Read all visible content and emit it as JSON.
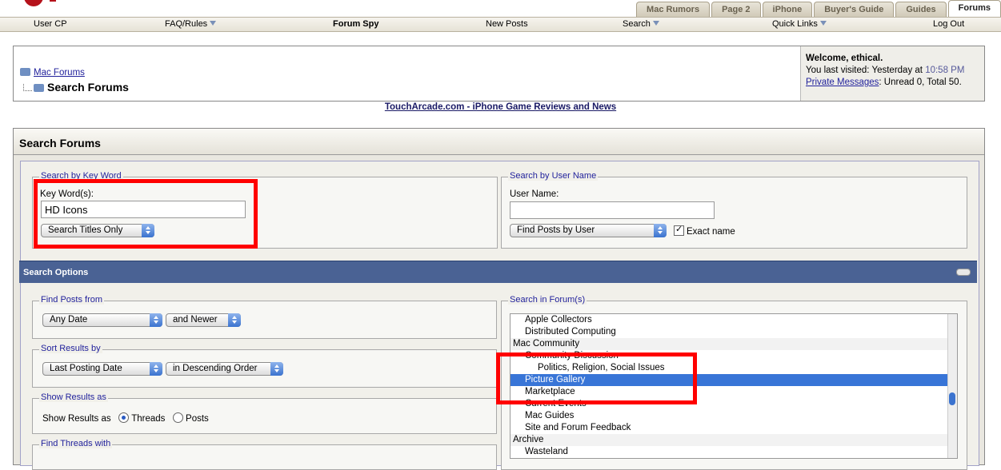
{
  "tabs": [
    "Mac Rumors",
    "Page 2",
    "iPhone",
    "Buyer's Guide",
    "Guides",
    "Forums"
  ],
  "active_tab": "Forums",
  "navbar": {
    "user_cp": "User CP",
    "faq": "FAQ/Rules",
    "forum_spy": "Forum Spy",
    "new_posts": "New Posts",
    "search": "Search",
    "quick_links": "Quick Links",
    "log_out": "Log Out"
  },
  "breadcrumb": {
    "parent": "Mac Forums",
    "current": "Search Forums"
  },
  "welcome": {
    "title": "Welcome, ethical.",
    "visited_prefix": "You last visited: Yesterday at",
    "visited_time": "10:58 PM",
    "pm_link": "Private Messages",
    "pm_suffix": ": Unread 0, Total 50."
  },
  "ad_link": "TouchArcade.com - iPhone Game Reviews and News",
  "panel_title": "Search Forums",
  "keyword": {
    "legend": "Search by Key Word",
    "label": "Key Word(s):",
    "value": "HD Icons",
    "mode": "Search Titles Only"
  },
  "username": {
    "legend": "Search by User Name",
    "label": "User Name:",
    "value": "",
    "mode": "Find Posts by User",
    "exact_label": "Exact name"
  },
  "options_bar": "Search Options",
  "find_posts": {
    "legend": "Find Posts from",
    "date": "Any Date",
    "direction": "and Newer"
  },
  "sort": {
    "legend": "Sort Results by",
    "by": "Last Posting Date",
    "order": "in Descending Order"
  },
  "show": {
    "legend": "Show Results as",
    "label": "Show Results as",
    "threads": "Threads",
    "posts": "Posts"
  },
  "find_threads": {
    "legend": "Find Threads with"
  },
  "forums": {
    "legend": "Search in Forum(s)",
    "items": [
      "Apple Collectors",
      "Distributed Computing",
      "Mac Community",
      "Community Discussion",
      "Politics, Religion, Social Issues",
      "Picture Gallery",
      "Marketplace",
      "Current Events",
      "Mac Guides",
      "Site and Forum Feedback",
      "Archive",
      "Wasteland"
    ]
  },
  "colors": {
    "highlight": "#ff0000",
    "bar": "#4a6294",
    "selected": "#3875d7"
  }
}
